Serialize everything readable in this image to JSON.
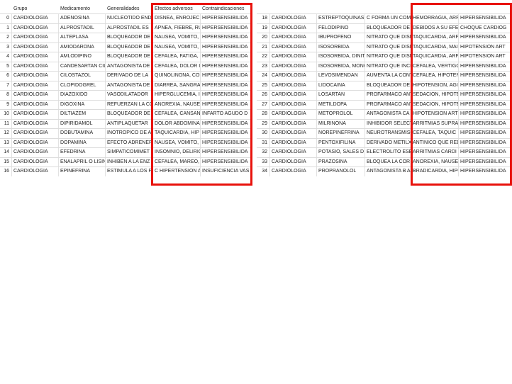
{
  "headers": [
    "Grupo",
    "Medicamento",
    "Generalidades",
    "Efectos adversos",
    "Contraindicaciones"
  ],
  "left_rows": [
    [
      "0",
      "CARDIOLOGIA",
      "ADENOSINA",
      "NUCLEOTIDO ENDO",
      "DISNEA, ENROJECI",
      "HIPERSENSIBILIDA"
    ],
    [
      "1",
      "CARDIOLOGIA",
      "ALPROSTADIL",
      "ALPROSTADIL ES",
      "APNEA, FIEBRE, RU",
      "HIPERSENSIBILIDA"
    ],
    [
      "2",
      "CARDIOLOGIA",
      "ALTEPLASA",
      "BLOQUEADOR DE",
      "NAUSEA, VOMITO,",
      "HIPERSENSIBILIDA"
    ],
    [
      "3",
      "CARDIOLOGIA",
      "AMIODARONA",
      "BLOQUEADOR DE",
      "NAUSEA, VOMITO,",
      "HIPERSENSIBILIDA"
    ],
    [
      "4",
      "CARDIOLOGIA",
      "AMLODIPINO",
      "BLOQUEADOR DE",
      "CEFALEA, FATIGA,",
      "HIPERSENSIBILIDA"
    ],
    [
      "5",
      "CARDIOLOGIA",
      "CANDESARTAN CIL",
      "ANTAGONISTA DE",
      "CEFALEA, DOLOR I",
      "HIPERSENSIBILIDA"
    ],
    [
      "6",
      "CARDIOLOGIA",
      "CILOSTAZOL",
      "DERIVADO DE LA",
      "QUINOLINONA, CON E",
      "HIPERSENSIBILIDA"
    ],
    [
      "7",
      "CARDIOLOGIA",
      "CLOPIDOGREL",
      "ANTAGONISTA DE",
      "DIARREA, SANGRA",
      "HIPERSENSIBILIDA"
    ],
    [
      "8",
      "CARDIOLOGIA",
      "DIAZOXIDO",
      "VASODILATADOR",
      "HIPERGLUCEMIA, I",
      "HIPERSENSIBILIDA"
    ],
    [
      "9",
      "CARDIOLOGIA",
      "DIGOXINA",
      "REFUERZAN LA CO",
      "ANOREXIA, NAUSE",
      "HIPERSENSIBILIDA"
    ],
    [
      "10",
      "CARDIOLOGIA",
      "DILTIAZEM",
      "BLOQUEADOR DE",
      "CEFALEA, CANSAN",
      "INFARTO AGUDO D"
    ],
    [
      "11",
      "CARDIOLOGIA",
      "DIPIRIDAMOL",
      "ANTIPLAQUETAR",
      "DOLOR ABDOMINA",
      "HIPERSENSIBILIDA"
    ],
    [
      "12",
      "CARDIOLOGIA",
      "DOBUTAMINA",
      "INOTROPICO DE A",
      "TAQUICARDIA, HIP",
      "HIPERSENSIBILIDA"
    ],
    [
      "13",
      "CARDIOLOGIA",
      "DOPAMINA",
      "EFECTO ADRENER",
      "NAUSEA, VOMITO,",
      "HIPERSENSIBILIDA"
    ],
    [
      "14",
      "CARDIOLOGIA",
      "EFEDRINA",
      "SIMPATICOMIMET",
      "INSOMNIO, DELIRIO",
      "HIPERSENSIBILIDA"
    ],
    [
      "15",
      "CARDIOLOGIA",
      "ENALAPRIL O LISIN",
      "INHIBEN A LA ENZ",
      "CEFALEA, MAREO,",
      "HIPERSENSIBILIDA"
    ],
    [
      "16",
      "CARDIOLOGIA",
      "EPINEFRINA",
      "ESTIMULA A LOS F",
      "C HIPERTENSION A",
      "INSUFICIENCIA VAS"
    ]
  ],
  "right_rows": [
    [
      "18",
      "CARDIOLOGIA",
      "ESTREPTOQUINAS",
      "C FORMA UN COMI",
      "HEMORRAGIA, ARF",
      "HIPERSENSIBILIDA"
    ],
    [
      "19",
      "CARDIOLOGIA",
      "FELODIPINO",
      "BLOQUEADOR DE E",
      "DEBIDOS A SU EFE",
      "CHOQUE CARDIOG"
    ],
    [
      "20",
      "CARDIOLOGIA",
      "IBUPROFENO",
      "NITRATO QUE DISM",
      "TAQUICARDIA, ARF",
      "HIPERSENSIBILIDA"
    ],
    [
      "21",
      "CARDIOLOGIA",
      "ISOSORBIDA",
      "NITRATO QUE DISM",
      "TAQUICARDIA, MAI",
      "HIPOTENSION ART"
    ],
    [
      "22",
      "CARDIOLOGIA",
      "ISOSORBIDA, DINIT",
      "NITRATO QUE DISM",
      "TAQUICARDIA, ARF",
      "HIPOTENSION ART"
    ],
    [
      "23",
      "CARDIOLOGIA",
      "ISOSORBIDA, MONO",
      "NITRATO QUE INCR",
      "CEFALEA, VERTIGO",
      "HIPERSENSIBILIDA"
    ],
    [
      "24",
      "CARDIOLOGIA",
      "LEVOSIMENDAN",
      "AUMENTA LA CONT",
      "CEFALEA, HIPOTEN",
      "HIPERSENSIBILIDA"
    ],
    [
      "25",
      "CARDIOLOGIA",
      "LIDOCAINA",
      "BLOQUEADOR DE",
      "HIPOTENSION, AGI",
      "HIPERSENSIBILIDA"
    ],
    [
      "26",
      "CARDIOLOGIA",
      "LOSARTAN",
      "PROFARMACO ANT",
      "SEDACION, HIPOTE",
      "HIPERSENSIBILIDA"
    ],
    [
      "27",
      "CARDIOLOGIA",
      "METILDOPA",
      "PROFARMACO ANT",
      "SEDACION, HIPOTE",
      "HIPERSENSIBILIDA"
    ],
    [
      "28",
      "CARDIOLOGIA",
      "METOPROLOL",
      "ANTAGONISTA CA",
      "HIPOTENSION ART",
      "HIPERSENSIBILIDA"
    ],
    [
      "29",
      "CARDIOLOGIA",
      "MILRINONA",
      "INHIBIDOR SELECT",
      "ARRITMIAS SUPRA",
      "HIPERSENSIBILIDA"
    ],
    [
      "30",
      "CARDIOLOGIA",
      "NOREPINEFRINA",
      "NEUROTRANSMISO",
      "CEFALEA, TAQUIC",
      "HIPERSENSIBILIDA"
    ],
    [
      "31",
      "CARDIOLOGIA",
      "PENTOXIFILINA",
      "DERIVADO METILX",
      "ANTINICO QUE REDU",
      "HIPERSENSIBILIDA"
    ],
    [
      "32",
      "CARDIOLOGIA",
      "POTASIO, SALES D",
      "ELECTROLITO ESE",
      "ARRITMIAS CARDI",
      "HIPERSENSIBILIDA"
    ],
    [
      "33",
      "CARDIOLOGIA",
      "PRAZOSINA",
      "BLOQUEA LA COR",
      "ANOREXIA, NAUSE",
      "HIPERSENSIBILIDA"
    ],
    [
      "34",
      "CARDIOLOGIA",
      "PROPRANOLOL",
      "ANTAGONISTA B A",
      "BRADICARDIA, HIPO",
      "HIPERSENSIBILIDA"
    ]
  ],
  "highlight_color": "#e8120c"
}
